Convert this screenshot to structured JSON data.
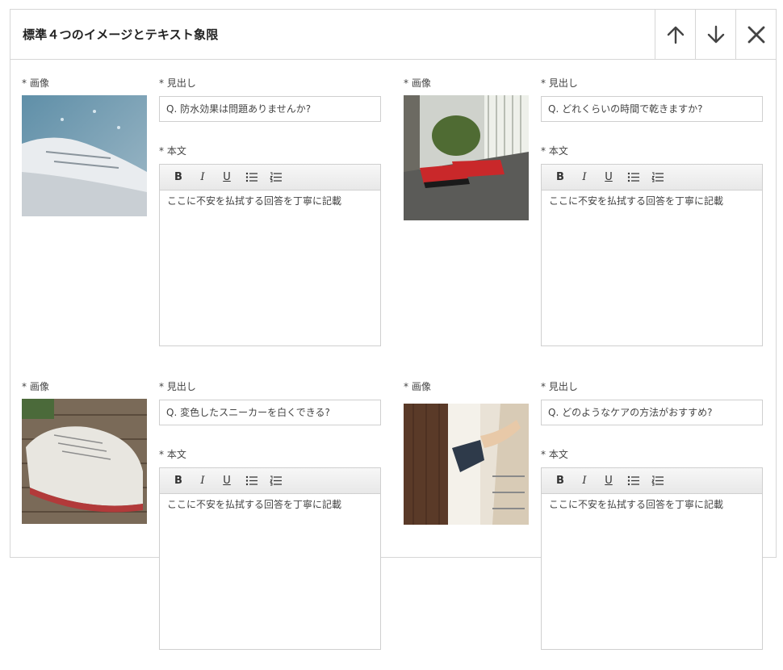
{
  "header": {
    "title": "標準４つのイメージとテキスト象限",
    "move_up_label": "move up",
    "move_down_label": "move down",
    "close_label": "close"
  },
  "labels": {
    "image": "* 画像",
    "heading": "* 見出し",
    "body": "* 本文"
  },
  "toolbar": {
    "bold": "B",
    "italic": "I",
    "underline": "U"
  },
  "quadrants": [
    {
      "heading_value": "Q. 防水効果は問題ありませんか?",
      "body_text": "ここに不安を払拭する回答を丁寧に記載"
    },
    {
      "heading_value": "Q. どれくらいの時間で乾きますか?",
      "body_text": "ここに不安を払拭する回答を丁寧に記載"
    },
    {
      "heading_value": "Q. 変色したスニーカーを白くできる?",
      "body_text": "ここに不安を払拭する回答を丁寧に記載"
    },
    {
      "heading_value": "Q. どのようなケアの方法がおすすめ?",
      "body_text": "ここに不安を払拭する回答を丁寧に記載"
    }
  ],
  "icons": {
    "up": "arrow-up-icon",
    "down": "arrow-down-icon",
    "close": "close-icon",
    "bullet_list": "bullet-list-icon",
    "numbered_list": "numbered-list-icon"
  }
}
